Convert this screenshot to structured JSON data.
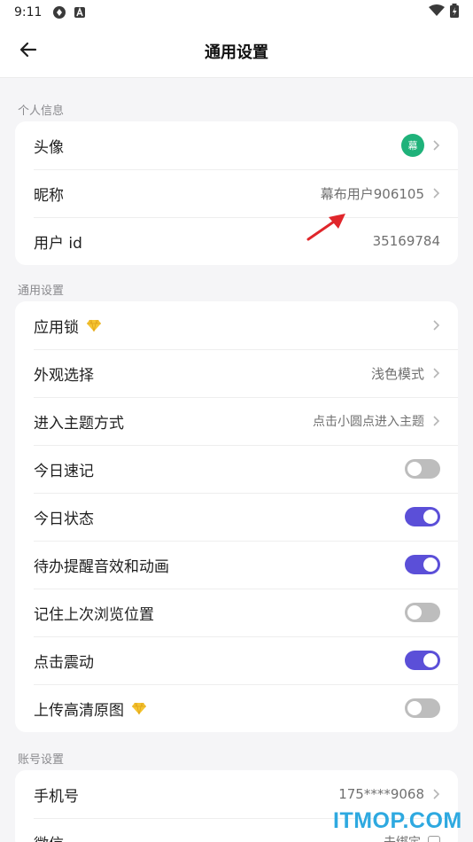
{
  "status_bar": {
    "time": "9:11"
  },
  "header": {
    "title": "通用设置"
  },
  "sections": {
    "personal": {
      "label": "个人信息",
      "avatar": {
        "label": "头像",
        "avatar_text": "幕",
        "avatar_color": "#1fb27a"
      },
      "nickname": {
        "label": "昵称",
        "value": "幕布用户906105"
      },
      "user_id": {
        "label": "用户 id",
        "value": "35169784"
      }
    },
    "general": {
      "label": "通用设置",
      "app_lock": {
        "label": "应用锁",
        "premium": true
      },
      "appearance": {
        "label": "外观选择",
        "value": "浅色模式"
      },
      "theme_entry": {
        "label": "进入主题方式",
        "value": "点击小圆点进入主题"
      },
      "quick_note": {
        "label": "今日速记",
        "enabled": false
      },
      "today_status": {
        "label": "今日状态",
        "enabled": true
      },
      "todo_sound": {
        "label": "待办提醒音效和动画",
        "enabled": true
      },
      "remember_position": {
        "label": "记住上次浏览位置",
        "enabled": false
      },
      "click_vibration": {
        "label": "点击震动",
        "enabled": true
      },
      "hd_upload": {
        "label": "上传高清原图",
        "premium": true,
        "enabled": false
      }
    },
    "account": {
      "label": "账号设置",
      "phone": {
        "label": "手机号",
        "value": "175****9068"
      },
      "wechat": {
        "label": "微信",
        "value": "未绑定"
      }
    }
  },
  "watermark": "ITMOP.COM",
  "colors": {
    "accent": "#5b4fd8",
    "toggle_off": "#bdbdbd",
    "avatar": "#1fb27a",
    "watermark": "#2ea9e0",
    "arrow": "#e0262b"
  }
}
